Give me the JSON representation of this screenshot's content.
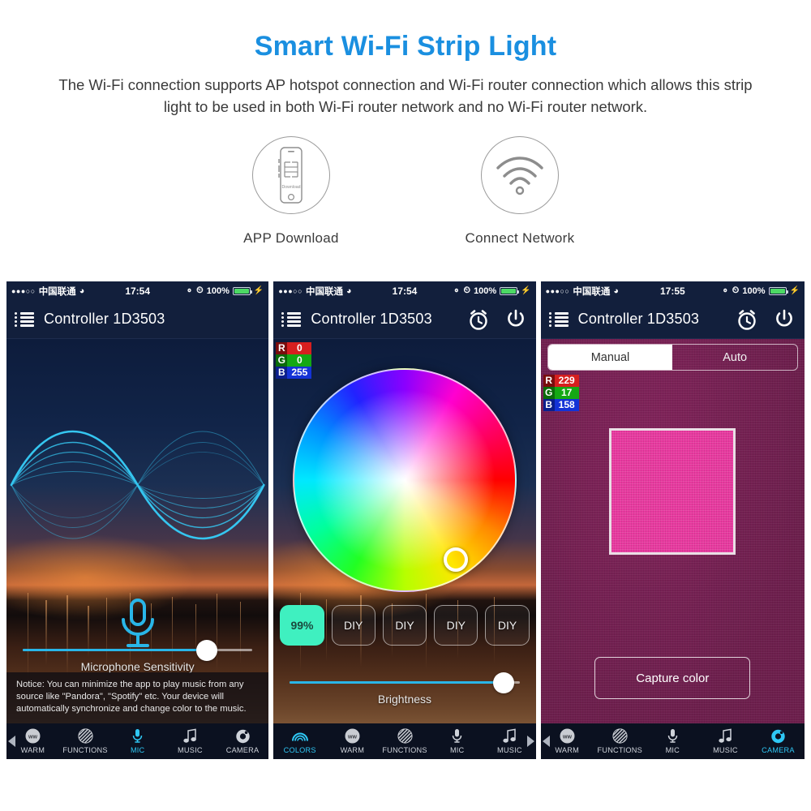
{
  "header": {
    "title": "Smart Wi-Fi Strip Light",
    "subtitle": "The Wi-Fi connection supports AP hotspot connection and Wi-Fi router connection which allows this strip light to be used in both Wi-Fi router network and no Wi-Fi router network.",
    "title_color": "#1a8fe0"
  },
  "features": [
    {
      "icon": "phone-download-icon",
      "label": "APP Download",
      "screen_text": "Download"
    },
    {
      "icon": "wifi-icon",
      "label": "Connect Network"
    }
  ],
  "panels": [
    {
      "id": "mic-panel",
      "status": {
        "dots": "●●●○○",
        "carrier": "中国联通",
        "wifi": "wifi-icon",
        "time": "17:54",
        "lock_icon": "rotation-lock-icon",
        "alarm_icon": "alarm-icon",
        "battery_pct": "100%",
        "charging": "⚡"
      },
      "nav": {
        "menu_icon": "hamburger-menu-icon",
        "title": "Controller 1D3503",
        "actions": []
      },
      "slider": {
        "label": "Microphone Sensitivity",
        "value": 80
      },
      "notice": "Notice: You can minimize the app to play music from any source like \"Pandora\", \"Spotify\" etc. Your device will automatically synchronize and change color to the music.",
      "tabs": [
        {
          "label": "WARM",
          "icon": "warm-ww-icon",
          "active": false
        },
        {
          "label": "FUNCTIONS",
          "icon": "functions-stripes-icon",
          "active": false
        },
        {
          "label": "MIC",
          "icon": "microphone-icon",
          "active": true
        },
        {
          "label": "MUSIC",
          "icon": "music-note-icon",
          "active": false
        },
        {
          "label": "CAMERA",
          "icon": "camera-icon",
          "active": false
        }
      ],
      "arrow_left": true,
      "arrow_right": false
    },
    {
      "id": "colors-panel",
      "status": {
        "dots": "●●●○○",
        "carrier": "中国联通",
        "wifi": "wifi-icon",
        "time": "17:54",
        "lock_icon": "rotation-lock-icon",
        "alarm_icon": "alarm-icon",
        "battery_pct": "100%",
        "charging": "⚡"
      },
      "nav": {
        "menu_icon": "hamburger-menu-icon",
        "title": "Controller 1D3503",
        "actions": [
          "alarm-icon",
          "power-icon"
        ]
      },
      "rgb": {
        "r_label": "R",
        "r": "0",
        "g_label": "G",
        "g": "0",
        "b_label": "B",
        "b": "255"
      },
      "wheel": {
        "selector_x_pct": 73,
        "selector_y_pct": 86
      },
      "presets": [
        {
          "label": "99%",
          "filled": true
        },
        {
          "label": "DIY",
          "filled": false
        },
        {
          "label": "DIY",
          "filled": false
        },
        {
          "label": "DIY",
          "filled": false
        },
        {
          "label": "DIY",
          "filled": false
        }
      ],
      "slider": {
        "label": "Brightness",
        "value": 93
      },
      "tabs": [
        {
          "label": "COLORS",
          "icon": "rainbow-icon",
          "active": true
        },
        {
          "label": "WARM",
          "icon": "warm-ww-icon",
          "active": false
        },
        {
          "label": "FUNCTIONS",
          "icon": "functions-stripes-icon",
          "active": false
        },
        {
          "label": "MIC",
          "icon": "microphone-icon",
          "active": false
        },
        {
          "label": "MUSIC",
          "icon": "music-note-icon",
          "active": false
        }
      ],
      "arrow_left": false,
      "arrow_right": true
    },
    {
      "id": "camera-panel",
      "status": {
        "dots": "●●●○○",
        "carrier": "中国联通",
        "wifi": "wifi-icon",
        "time": "17:55",
        "lock_icon": "rotation-lock-icon",
        "alarm_icon": "alarm-icon",
        "battery_pct": "100%",
        "charging": "⚡"
      },
      "nav": {
        "menu_icon": "hamburger-menu-icon",
        "title": "Controller 1D3503",
        "actions": [
          "alarm-icon",
          "power-icon"
        ]
      },
      "segment": [
        {
          "label": "Manual",
          "selected": true
        },
        {
          "label": "Auto",
          "selected": false
        }
      ],
      "rgb": {
        "r_label": "R",
        "r": "229",
        "g_label": "G",
        "g": "17",
        "b_label": "B",
        "b": "158"
      },
      "swatch_color": "#e8399f",
      "capture_button": "Capture color",
      "tabs": [
        {
          "label": "WARM",
          "icon": "warm-ww-icon",
          "active": false
        },
        {
          "label": "FUNCTIONS",
          "icon": "functions-stripes-icon",
          "active": false
        },
        {
          "label": "MIC",
          "icon": "microphone-icon",
          "active": false
        },
        {
          "label": "MUSIC",
          "icon": "music-note-icon",
          "active": false
        },
        {
          "label": "CAMERA",
          "icon": "camera-icon",
          "active": true
        }
      ],
      "arrow_left": true,
      "arrow_right": false
    }
  ]
}
